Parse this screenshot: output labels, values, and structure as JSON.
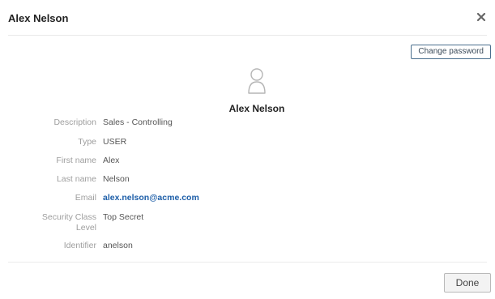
{
  "dialog": {
    "title": "Alex Nelson",
    "close_icon": "close-icon"
  },
  "actions": {
    "change_password_label": "Change password",
    "done_label": "Done"
  },
  "profile": {
    "avatar_icon": "user-icon",
    "name": "Alex Nelson",
    "fields": [
      {
        "label": "Description",
        "value": "Sales - Controlling"
      },
      {
        "label": "Type",
        "value": "USER"
      },
      {
        "label": "First name",
        "value": "Alex"
      },
      {
        "label": "Last name",
        "value": "Nelson"
      },
      {
        "label": "Email",
        "value": "alex.nelson@acme.com"
      },
      {
        "label": "Security Class Level",
        "value": "Top Secret"
      },
      {
        "label": "Identifier",
        "value": "anelson"
      }
    ]
  },
  "colors": {
    "link": "#1d5ea8",
    "button_border": "#4a6f8e",
    "label": "#9e9e9e"
  }
}
